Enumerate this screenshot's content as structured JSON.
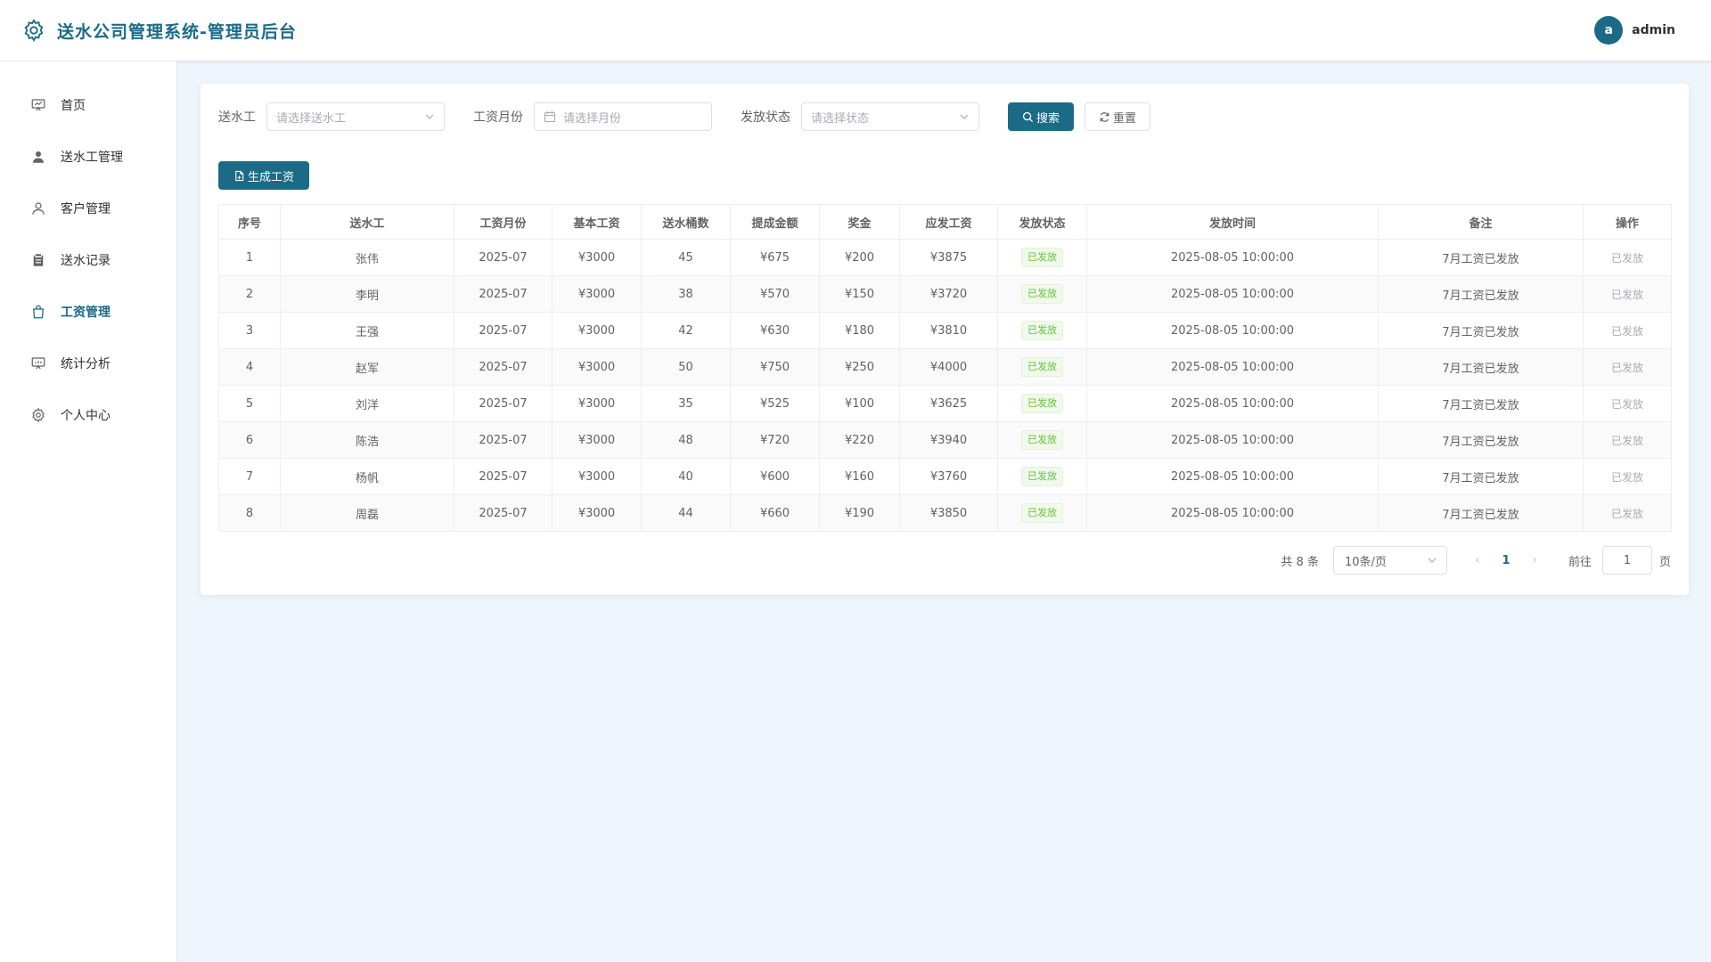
{
  "header": {
    "title": "送水公司管理系统-管理员后台",
    "avatar_letter": "a",
    "username": "admin"
  },
  "sidebar": {
    "items": [
      {
        "label": "首页",
        "icon": "dashboard-icon",
        "active": false
      },
      {
        "label": "送水工管理",
        "icon": "user-filled-icon",
        "active": false
      },
      {
        "label": "客户管理",
        "icon": "user-icon",
        "active": false
      },
      {
        "label": "送水记录",
        "icon": "clipboard-icon",
        "active": false
      },
      {
        "label": "工资管理",
        "icon": "shopping-bag-icon",
        "active": true
      },
      {
        "label": "统计分析",
        "icon": "data-board-icon",
        "active": false
      },
      {
        "label": "个人中心",
        "icon": "gear-icon",
        "active": false
      }
    ]
  },
  "filters": {
    "worker_label": "送水工",
    "worker_placeholder": "请选择送水工",
    "month_label": "工资月份",
    "month_placeholder": "请选择月份",
    "status_label": "发放状态",
    "status_placeholder": "请选择状态",
    "search_label": "搜索",
    "reset_label": "重置"
  },
  "toolbar": {
    "generate_label": "生成工资"
  },
  "table": {
    "columns": [
      "序号",
      "送水工",
      "工资月份",
      "基本工资",
      "送水桶数",
      "提成金额",
      "奖金",
      "应发工资",
      "发放状态",
      "发放时间",
      "备注",
      "操作"
    ],
    "rows": [
      {
        "no": "1",
        "worker": "张伟",
        "month": "2025-07",
        "base": "¥3000",
        "barrels": "45",
        "commission": "¥675",
        "bonus": "¥200",
        "total": "¥3875",
        "status": "已发放",
        "time": "2025-08-05 10:00:00",
        "remark": "7月工资已发放",
        "action": "已发放"
      },
      {
        "no": "2",
        "worker": "李明",
        "month": "2025-07",
        "base": "¥3000",
        "barrels": "38",
        "commission": "¥570",
        "bonus": "¥150",
        "total": "¥3720",
        "status": "已发放",
        "time": "2025-08-05 10:00:00",
        "remark": "7月工资已发放",
        "action": "已发放"
      },
      {
        "no": "3",
        "worker": "王强",
        "month": "2025-07",
        "base": "¥3000",
        "barrels": "42",
        "commission": "¥630",
        "bonus": "¥180",
        "total": "¥3810",
        "status": "已发放",
        "time": "2025-08-05 10:00:00",
        "remark": "7月工资已发放",
        "action": "已发放"
      },
      {
        "no": "4",
        "worker": "赵军",
        "month": "2025-07",
        "base": "¥3000",
        "barrels": "50",
        "commission": "¥750",
        "bonus": "¥250",
        "total": "¥4000",
        "status": "已发放",
        "time": "2025-08-05 10:00:00",
        "remark": "7月工资已发放",
        "action": "已发放"
      },
      {
        "no": "5",
        "worker": "刘洋",
        "month": "2025-07",
        "base": "¥3000",
        "barrels": "35",
        "commission": "¥525",
        "bonus": "¥100",
        "total": "¥3625",
        "status": "已发放",
        "time": "2025-08-05 10:00:00",
        "remark": "7月工资已发放",
        "action": "已发放"
      },
      {
        "no": "6",
        "worker": "陈浩",
        "month": "2025-07",
        "base": "¥3000",
        "barrels": "48",
        "commission": "¥720",
        "bonus": "¥220",
        "total": "¥3940",
        "status": "已发放",
        "time": "2025-08-05 10:00:00",
        "remark": "7月工资已发放",
        "action": "已发放"
      },
      {
        "no": "7",
        "worker": "杨帆",
        "month": "2025-07",
        "base": "¥3000",
        "barrels": "40",
        "commission": "¥600",
        "bonus": "¥160",
        "total": "¥3760",
        "status": "已发放",
        "time": "2025-08-05 10:00:00",
        "remark": "7月工资已发放",
        "action": "已发放"
      },
      {
        "no": "8",
        "worker": "周磊",
        "month": "2025-07",
        "base": "¥3000",
        "barrels": "44",
        "commission": "¥660",
        "bonus": "¥190",
        "total": "¥3850",
        "status": "已发放",
        "time": "2025-08-05 10:00:00",
        "remark": "7月工资已发放",
        "action": "已发放"
      }
    ]
  },
  "pagination": {
    "total_text": "共 8 条",
    "page_size": "10条/页",
    "current_page": "1",
    "goto_label": "前往",
    "goto_value": "1",
    "page_suffix": "页"
  },
  "colors": {
    "primary": "#1b6b86",
    "success": "#67c23a",
    "background": "#eef5fc"
  }
}
